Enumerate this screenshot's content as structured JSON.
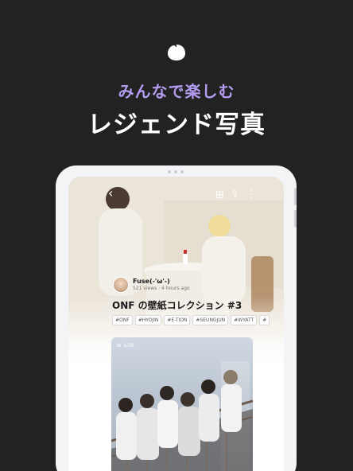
{
  "promo": {
    "subtitle": "みんなで楽しむ",
    "title": "レジェンド写真"
  },
  "topbar": {
    "back_icon": "‹",
    "gallery_icon": "⊞",
    "share_icon": "⇪",
    "more_icon": "⋮"
  },
  "post": {
    "author_name": "Fuse(-'ω'-)",
    "author_meta": "521 views · 4 hours ago",
    "title": "ONF の壁紙コレクション #3",
    "tags": [
      "#ONF",
      "#HYOJIN",
      "#E-TION",
      "#SEUNGJUN",
      "#WYATT",
      "#"
    ]
  },
  "card": {
    "counter_icon": "⊞",
    "counter": "1/30"
  },
  "colors": {
    "background": "#232223",
    "accent": "#b39cf2",
    "title": "#ffffff"
  }
}
